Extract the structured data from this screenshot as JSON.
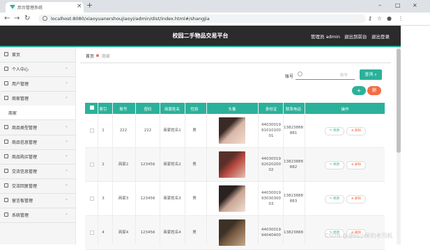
{
  "browser": {
    "tab_title": "后台管理系统",
    "url": "localhost:8080/xiaoyuanershoujiaoyi/admin/dist/index.html#/shangjia"
  },
  "header": {
    "title": "校园二手物品交易平台",
    "admin_label": "管理员 admin",
    "front_link": "退出到前台",
    "logout_link": "退出登录"
  },
  "sidebar": {
    "items": [
      {
        "label": "首页",
        "icon": "home-icon"
      },
      {
        "label": "个人中心",
        "icon": "user-icon"
      },
      {
        "label": "用户管理",
        "icon": "users-icon"
      },
      {
        "label": "商家管理",
        "icon": "store-icon"
      },
      {
        "label": "商品类型管理",
        "icon": "category-icon"
      },
      {
        "label": "商品信息管理",
        "icon": "goods-icon"
      },
      {
        "label": "商品购买管理",
        "icon": "cart-icon"
      },
      {
        "label": "交流信息管理",
        "icon": "message-icon"
      },
      {
        "label": "交流回复管理",
        "icon": "reply-icon"
      },
      {
        "label": "留言板管理",
        "icon": "board-icon"
      },
      {
        "label": "系统管理",
        "icon": "settings-icon"
      }
    ],
    "sub_item": "商家"
  },
  "breadcrumb": {
    "home": "首页",
    "current": "商家"
  },
  "search": {
    "label": "账号",
    "placeholder": "账号",
    "button": "查询"
  },
  "actions": {
    "add": "+",
    "delete": "删"
  },
  "table": {
    "headers": [
      "索引",
      "账号",
      "密码",
      "商家姓名",
      "性别",
      "头像",
      "身份证",
      "联系电话",
      "操作"
    ],
    "rows": [
      {
        "index": "1",
        "account": "222",
        "password": "222",
        "name": "商家姓名1",
        "gender": "男",
        "idcard": [
          "44030019",
          "91010100",
          "01"
        ],
        "phone": [
          "13823888",
          "881"
        ]
      },
      {
        "index": "2",
        "account": "商家2",
        "password": "123456",
        "name": "商家姓名2",
        "gender": "男",
        "idcard": [
          "44030019",
          "92020200",
          "02"
        ],
        "phone": [
          "13823888",
          "882"
        ]
      },
      {
        "index": "3",
        "account": "商家3",
        "password": "123456",
        "name": "商家姓名3",
        "gender": "男",
        "idcard": [
          "44030019",
          "93030300",
          "03"
        ],
        "phone": [
          "13823888",
          "883"
        ]
      },
      {
        "index": "4",
        "account": "商家4",
        "password": "123456",
        "name": "商家姓名4",
        "gender": "男",
        "idcard": [
          "44030019",
          "94040400"
        ],
        "phone": [
          "13823888"
        ]
      }
    ],
    "edit_label": "修改",
    "delete_label": "删除"
  },
  "watermark": "CSDN @源码小屋的老司机",
  "colors": {
    "accent": "#2bb19a",
    "danger": "#f56c45",
    "header_bg": "#2b2b2b"
  }
}
